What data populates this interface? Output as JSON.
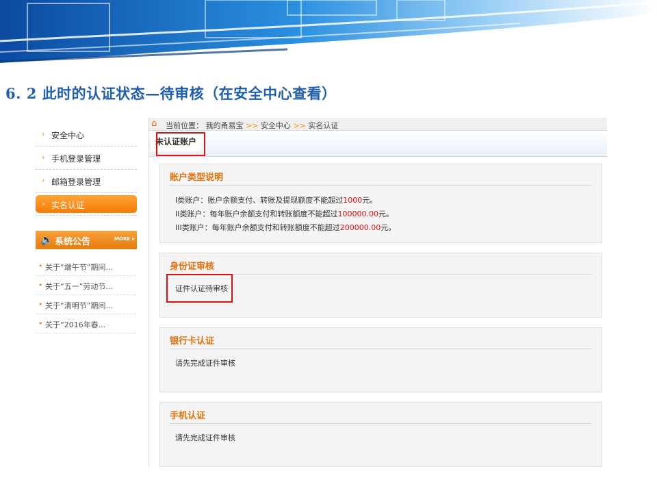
{
  "slide_title": "6. 2  此时的认证状态—待审核（在安全中心查看）",
  "sidebar": {
    "items": [
      {
        "label": "安全中心",
        "active": false
      },
      {
        "label": "手机登录管理",
        "active": false
      },
      {
        "label": "邮箱登录管理",
        "active": false
      },
      {
        "label": "实名认证",
        "active": true
      }
    ]
  },
  "notices": {
    "title": "系统公告",
    "more": "MORE",
    "items": [
      "关于“端午节”期间...",
      "关于“五一”劳动节...",
      "关于“清明节”期间...",
      "关于“2016年春..."
    ]
  },
  "breadcrumb": {
    "prefix": "当前位置：",
    "parts": [
      "我的甬易宝",
      "安全中心",
      "实名认证"
    ],
    "separator": ">>"
  },
  "tab": {
    "label": "未认证账户"
  },
  "account_types": {
    "title": "账户类型说明",
    "lines": [
      {
        "text": "I类账户：账户余额支付、转账及提现额度不能超过",
        "amount": "1000",
        "suffix": "元。"
      },
      {
        "text": "II类账户：每年账户余额支付和转账额度不能超过",
        "amount": "100000.00",
        "suffix": "元。"
      },
      {
        "text": "III类账户：每年账户余额支付和转账额度不能超过",
        "amount": "200000.00",
        "suffix": "元。"
      }
    ]
  },
  "id_card": {
    "title": "身份证审核",
    "status": "证件认证待审核"
  },
  "bank_card": {
    "title": "银行卡认证",
    "status": "请先完成证件审核"
  },
  "mobile": {
    "title": "手机认证",
    "status": "请先完成证件审核"
  },
  "colors": {
    "accent_orange": "#e0700a",
    "title_blue": "#1f5fae",
    "highlight_red": "#e01010"
  }
}
